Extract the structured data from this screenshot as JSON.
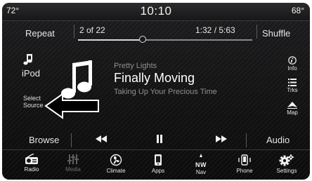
{
  "status": {
    "temp_left": "72°",
    "clock": "10:10",
    "temp_right": "68°"
  },
  "transport": {
    "repeat_label": "Repeat",
    "track_count": "2 of 22",
    "time": "1:32 / 5:63",
    "shuffle_label": "Shuffle",
    "progress_fraction": 0.37
  },
  "source": {
    "label": "iPod",
    "select_source_line1": "Select",
    "select_source_line2": "Source"
  },
  "now_playing": {
    "artist": "Pretty Lights",
    "title": "Finally Moving",
    "album": "Taking Up Your Precious Time"
  },
  "right_menu": {
    "info_label": "Info",
    "tracks_label": "Trks",
    "map_label": "Map"
  },
  "controls": {
    "browse_label": "Browse",
    "audio_label": "Audio"
  },
  "bottom_nav": {
    "radio": "Radio",
    "media": "Media",
    "climate": "Climate",
    "apps": "Apps",
    "nav": "Nav",
    "phone": "Phone",
    "settings": "Settings",
    "compass_n": "N",
    "compass_w": "W"
  },
  "colors": {
    "background": "#141415",
    "text": "#ffffff",
    "muted_text": "#8f8f91",
    "inactive_nav": "#6e6e70"
  }
}
